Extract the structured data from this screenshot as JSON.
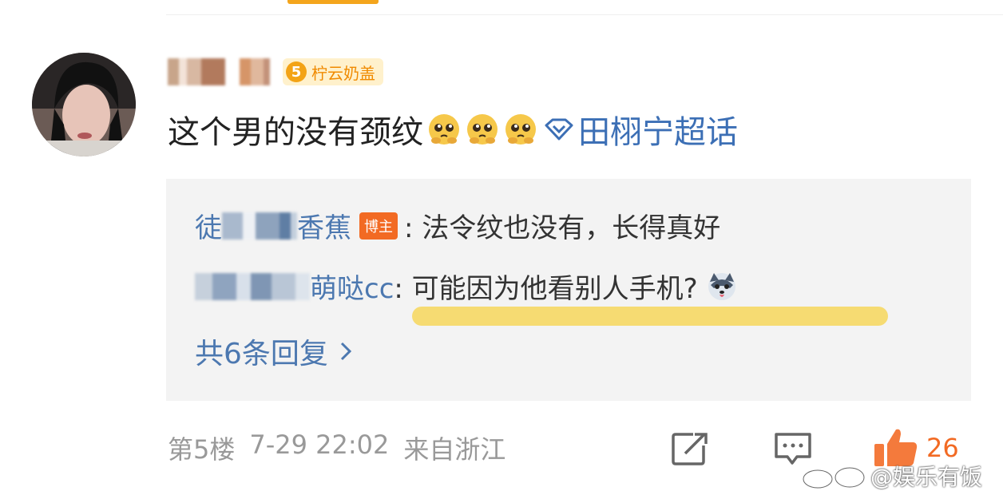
{
  "post": {
    "badge_level": "5",
    "badge_text": "柠云奶盖",
    "comment": "这个男的没有颈纹",
    "topic": "田栩宁超话"
  },
  "replies": [
    {
      "name_visible_a": "徒",
      "name_visible_b": "香蕉",
      "host_badge": "博主",
      "text": ": 法令纹也没有，长得真好"
    },
    {
      "name_visible": "萌哒cc",
      "text": ": 可能因为他看别人手机?"
    }
  ],
  "more_replies": "共6条回复",
  "footer": {
    "floor": "第5楼",
    "datetime": "7-29 22:02",
    "location": "来自浙江"
  },
  "likes": "26",
  "watermark": "@娱乐有饭",
  "icons": [
    "share-icon",
    "comment-icon",
    "like-icon",
    "weibo-logo-icon",
    "husky-emoji-icon",
    "pleading-emoji-icon",
    "diamond-topic-icon",
    "chevron-right-icon"
  ]
}
